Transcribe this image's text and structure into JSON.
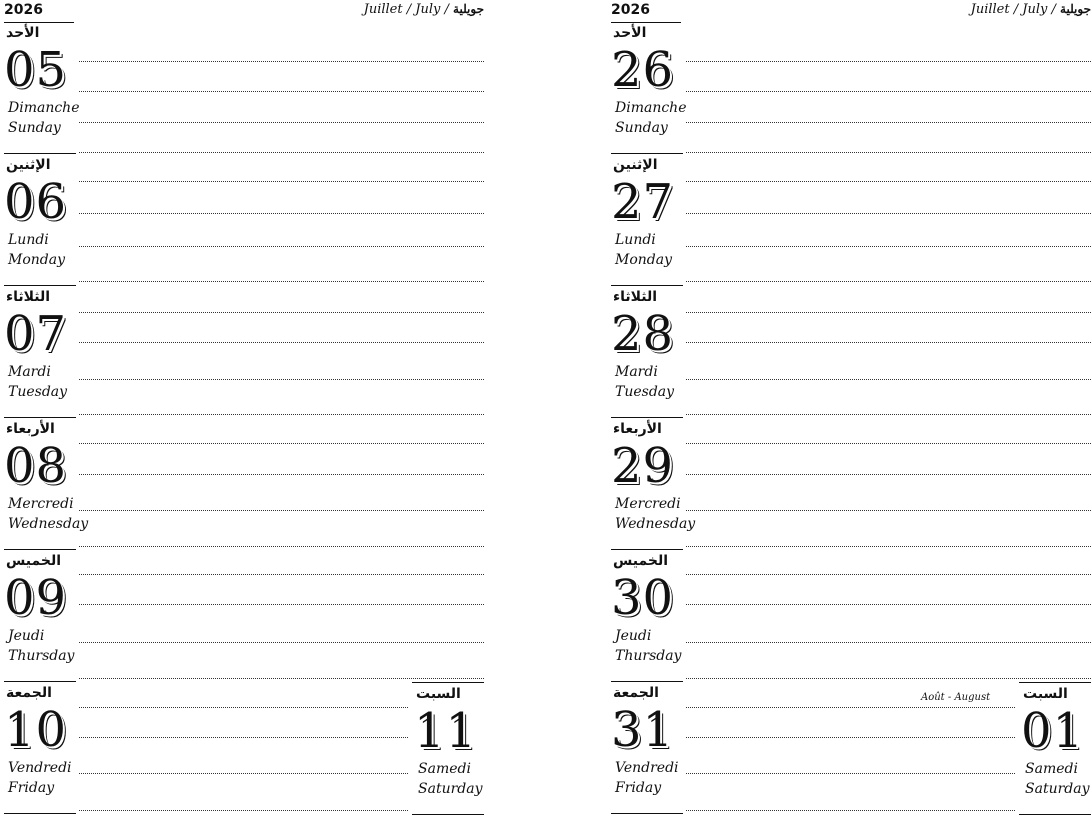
{
  "pages": [
    {
      "year": "2026",
      "month_fr": "Juillet",
      "month_en": "July",
      "month_ar": "جويلية",
      "days": [
        {
          "ar": "الأحد",
          "num": "05",
          "fr": "Dimanche",
          "en": "Sunday"
        },
        {
          "ar": "الإثنين",
          "num": "06",
          "fr": "Lundi",
          "en": "Monday"
        },
        {
          "ar": "الثلاثاء",
          "num": "07",
          "fr": "Mardi",
          "en": "Tuesday"
        },
        {
          "ar": "الأربعاء",
          "num": "08",
          "fr": "Mercredi",
          "en": "Wednesday"
        },
        {
          "ar": "الخميس",
          "num": "09",
          "fr": "Jeudi",
          "en": "Thursday"
        },
        {
          "ar": "الجمعة",
          "num": "10",
          "fr": "Vendredi",
          "en": "Friday"
        }
      ],
      "saturday": {
        "ar": "السبت",
        "num": "11",
        "fr": "Samedi",
        "en": "Saturday"
      }
    },
    {
      "year": "2026",
      "month_fr": "Juillet",
      "month_en": "July",
      "month_ar": "جويلية",
      "days": [
        {
          "ar": "الأحد",
          "num": "26",
          "fr": "Dimanche",
          "en": "Sunday"
        },
        {
          "ar": "الإثنين",
          "num": "27",
          "fr": "Lundi",
          "en": "Monday"
        },
        {
          "ar": "الثلاثاء",
          "num": "28",
          "fr": "Mardi",
          "en": "Tuesday"
        },
        {
          "ar": "الأربعاء",
          "num": "29",
          "fr": "Mercredi",
          "en": "Wednesday"
        },
        {
          "ar": "الخميس",
          "num": "30",
          "fr": "Jeudi",
          "en": "Thursday"
        },
        {
          "ar": "الجمعة",
          "num": "31",
          "fr": "Vendredi",
          "en": "Friday"
        }
      ],
      "saturday": {
        "ar": "السبت",
        "num": "01",
        "fr": "Samedi",
        "en": "Saturday"
      },
      "next_month_label": "Août - August"
    }
  ]
}
